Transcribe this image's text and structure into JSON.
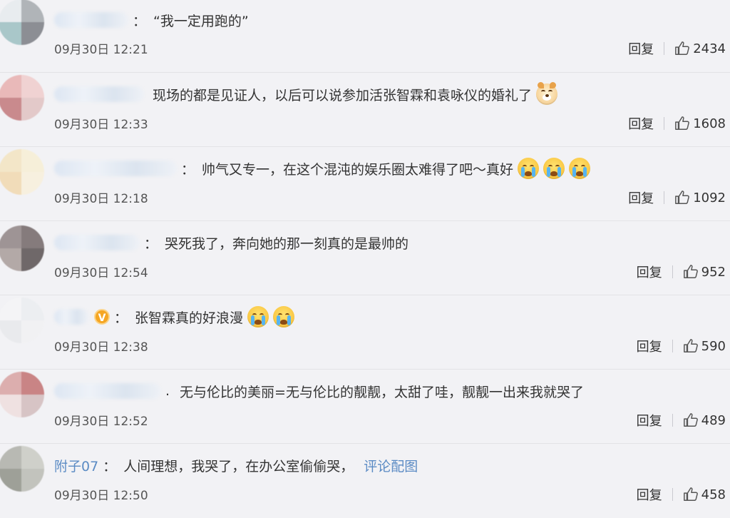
{
  "comments": [
    {
      "name": "",
      "text": "“我一定用跑的”",
      "time": "09月30日 12:21",
      "reply": "回复",
      "likes": "2434",
      "emoji": [],
      "vip": false,
      "avatar_colors": [
        "#e8ecef",
        "#b0b4b8",
        "#a9c7c9",
        "#8c8e94"
      ]
    },
    {
      "name": "",
      "text": "现场的都是见证人，以后可以说参加活张智霖和袁咏仪的婚礼了",
      "time": "09月30日 12:33",
      "reply": "回复",
      "likes": "1608",
      "emoji": [
        "dog"
      ],
      "vip": false,
      "avatar_colors": [
        "#e9b9b9",
        "#f0d2d2",
        "#c98a8d",
        "#e3c9c9"
      ]
    },
    {
      "name": "",
      "text": "帅气又专一，在这个混沌的娱乐圈太难得了吧～真好",
      "time": "09月30日 12:18",
      "reply": "回复",
      "likes": "1092",
      "emoji": [
        "cry",
        "cry",
        "cry"
      ],
      "vip": false,
      "avatar_colors": [
        "#f3e6c8",
        "#f6efd9",
        "#f1dcb9",
        "#f7f0df"
      ]
    },
    {
      "name": "",
      "text": "哭死我了，奔向她的那一刻真的是最帅的",
      "time": "09月30日 12:54",
      "reply": "回复",
      "likes": "952",
      "emoji": [],
      "vip": false,
      "avatar_colors": [
        "#9e9495",
        "#857b7c",
        "#b3a9a7",
        "#6f6869"
      ]
    },
    {
      "name": "",
      "text": "张智霖真的好浪漫",
      "time": "09月30日 12:38",
      "reply": "回复",
      "likes": "590",
      "emoji": [
        "cry",
        "cry"
      ],
      "vip": true,
      "vip_label": "V",
      "avatar_colors": [
        "#f4f4f6",
        "#eceef1",
        "#e9eaed",
        "#f1f1f3"
      ]
    },
    {
      "name": "",
      "text": "无与伦比的美丽=无与伦比的靓靓，太甜了哇，靓靓一出来我就哭了",
      "time": "09月30日 12:52",
      "reply": "回复",
      "likes": "489",
      "emoji": [],
      "vip": false,
      "avatar_colors": [
        "#dcaeae",
        "#c98485",
        "#efe1e1",
        "#d7c4c5"
      ]
    },
    {
      "name": "附子07",
      "text": "人间理想，我哭了，在办公室偷偷哭，",
      "link": "评论配图",
      "time": "09月30日 12:50",
      "reply": "回复",
      "likes": "458",
      "emoji": [],
      "vip": false,
      "avatar_colors": [
        "#b8b9b3",
        "#cfd0ca",
        "#9ea098",
        "#c2c3bd"
      ]
    }
  ]
}
